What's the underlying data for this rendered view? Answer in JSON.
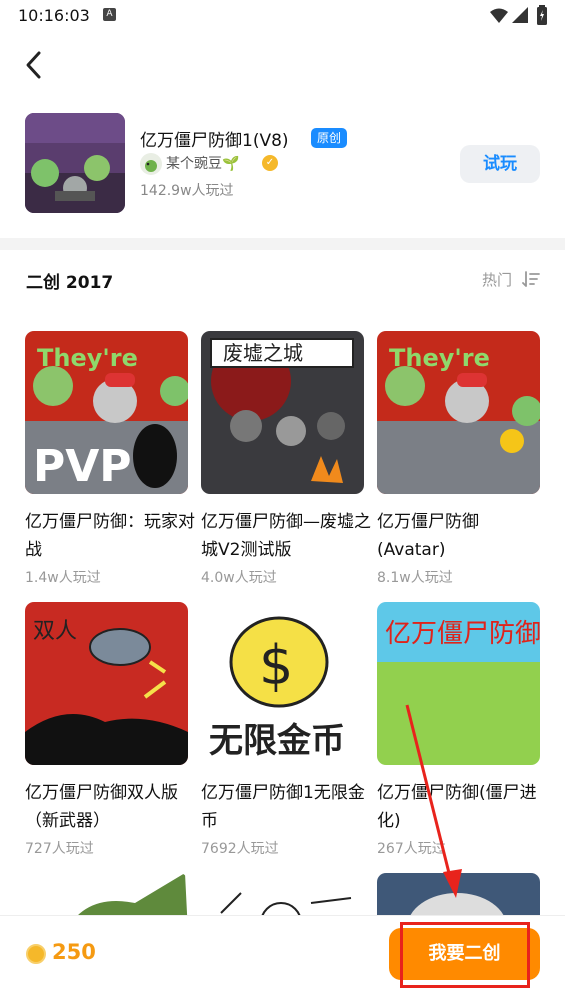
{
  "status": {
    "time": "10:16:03",
    "a_icon": "A"
  },
  "header": {
    "back_icon": "back-arrow-icon"
  },
  "game": {
    "title": "亿万僵尸防御1(V8)",
    "badge": "原创",
    "author": "某个豌豆🌱",
    "plays": "142.9w人玩过",
    "try_label": "试玩"
  },
  "section": {
    "title": "二创 2017",
    "sort_label": "热门"
  },
  "cards": [
    {
      "title": "亿万僵尸防御：玩家对战",
      "plays": "1.4w人玩过",
      "art": "PVP"
    },
    {
      "title": "亿万僵尸防御—废墟之城V2测试版",
      "plays": "4.0w人玩过",
      "art": "废墟之城"
    },
    {
      "title": "亿万僵尸防御(Avatar)",
      "plays": "8.1w人玩过",
      "art": ""
    },
    {
      "title": "亿万僵尸防御双人版（新武器）",
      "plays": "727人玩过",
      "art": "双人"
    },
    {
      "title": "亿万僵尸防御1无限金币",
      "plays": "7692人玩过",
      "art": "无限金币"
    },
    {
      "title": "亿万僵尸防御(僵尸进化)",
      "plays": "267人玩过",
      "art": "亿万僵尸防御"
    }
  ],
  "bottom": {
    "coins": "250",
    "cta": "我要二创"
  },
  "colors": {
    "accent": "#1a8cff",
    "cta": "#ff8a00",
    "highlight": "#e8231c"
  }
}
